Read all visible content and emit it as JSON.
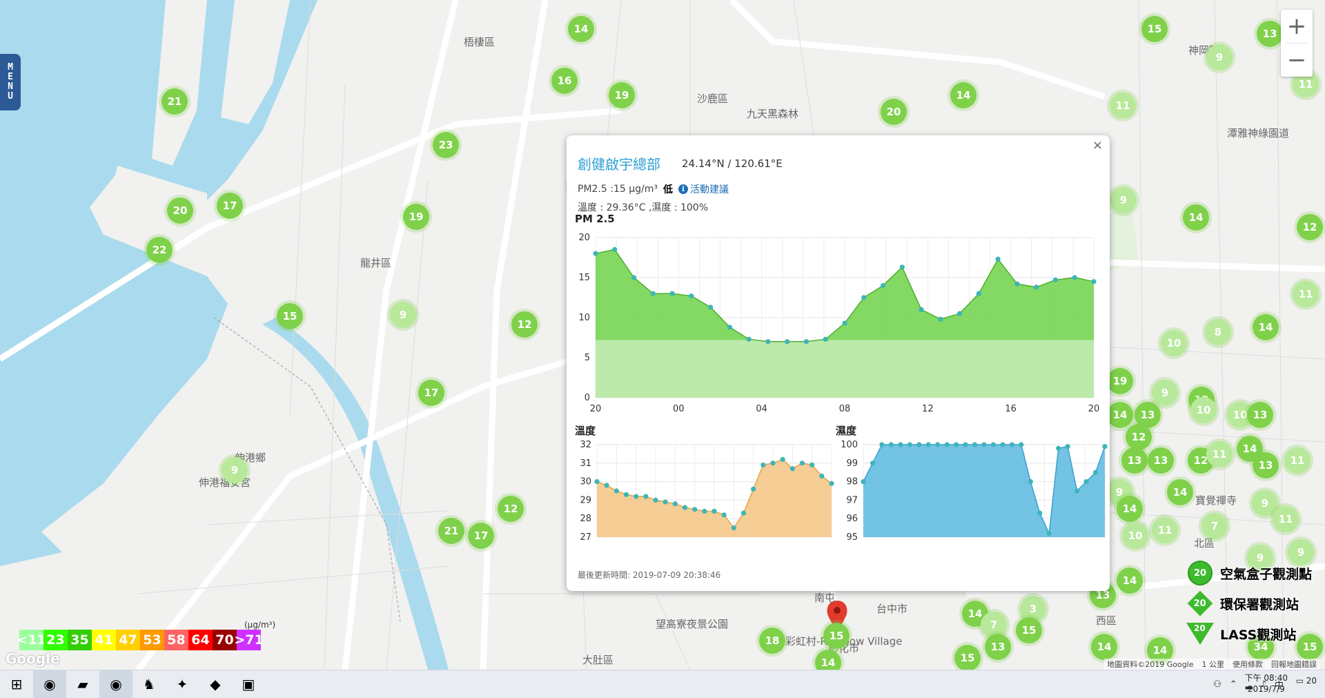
{
  "menu_label": "MENU",
  "zoom": {
    "in_label": "+",
    "out_label": "−"
  },
  "places": [
    {
      "name": "梧棲區",
      "x": 672,
      "y": 50
    },
    {
      "name": "沙鹿區",
      "x": 1010,
      "y": 132
    },
    {
      "name": "九天黑森林",
      "x": 1082,
      "y": 154
    },
    {
      "name": "龍井區",
      "x": 522,
      "y": 370
    },
    {
      "name": "伸港鄉",
      "x": 340,
      "y": 652
    },
    {
      "name": "伸港福安宮",
      "x": 288,
      "y": 688
    },
    {
      "name": "望高寮夜景公園",
      "x": 950,
      "y": 893
    },
    {
      "name": "大肚區",
      "x": 844,
      "y": 945
    },
    {
      "name": "彰化市",
      "x": 1200,
      "y": 928
    },
    {
      "name": "台中市",
      "x": 1270,
      "y": 871
    },
    {
      "name": "神岡區",
      "x": 1722,
      "y": 62
    },
    {
      "name": "潭雅神綠園道",
      "x": 1778,
      "y": 182
    },
    {
      "name": "寶覺禪寺",
      "x": 1732,
      "y": 714
    },
    {
      "name": "北區",
      "x": 1730,
      "y": 776
    },
    {
      "name": "西區",
      "x": 1588,
      "y": 888
    },
    {
      "name": "彩虹村-Rainbow Village",
      "x": 1138,
      "y": 918
    },
    {
      "name": "南屯",
      "x": 1180,
      "y": 855
    }
  ],
  "markers": [
    {
      "v": "14",
      "x": 842,
      "y": 42
    },
    {
      "v": "16",
      "x": 818,
      "y": 117
    },
    {
      "v": "19",
      "x": 901,
      "y": 138
    },
    {
      "v": "21",
      "x": 253,
      "y": 147
    },
    {
      "v": "23",
      "x": 646,
      "y": 210
    },
    {
      "v": "20",
      "x": 261,
      "y": 305
    },
    {
      "v": "17",
      "x": 333,
      "y": 298
    },
    {
      "v": "22",
      "x": 231,
      "y": 362
    },
    {
      "v": "19",
      "x": 603,
      "y": 314
    },
    {
      "v": "15",
      "x": 420,
      "y": 458
    },
    {
      "v": "9",
      "x": 584,
      "y": 456,
      "light": true
    },
    {
      "v": "12",
      "x": 760,
      "y": 470
    },
    {
      "v": "17",
      "x": 625,
      "y": 569
    },
    {
      "v": "9",
      "x": 340,
      "y": 681,
      "light": true
    },
    {
      "v": "12",
      "x": 740,
      "y": 737
    },
    {
      "v": "21",
      "x": 654,
      "y": 769
    },
    {
      "v": "17",
      "x": 697,
      "y": 776
    },
    {
      "v": "18",
      "x": 1119,
      "y": 928
    },
    {
      "v": "15",
      "x": 1212,
      "y": 921
    },
    {
      "v": "14",
      "x": 1200,
      "y": 960
    },
    {
      "v": "20",
      "x": 1295,
      "y": 162
    },
    {
      "v": "14",
      "x": 1396,
      "y": 138
    },
    {
      "v": "15",
      "x": 1673,
      "y": 42
    },
    {
      "v": "13",
      "x": 1840,
      "y": 49
    },
    {
      "v": "9",
      "x": 1767,
      "y": 83,
      "light": true
    },
    {
      "v": "11",
      "x": 1892,
      "y": 122,
      "light": true
    },
    {
      "v": "11",
      "x": 1627,
      "y": 153,
      "light": true
    },
    {
      "v": "9",
      "x": 1628,
      "y": 290,
      "light": true
    },
    {
      "v": "14",
      "x": 1733,
      "y": 315
    },
    {
      "v": "12",
      "x": 1898,
      "y": 329
    },
    {
      "v": "11",
      "x": 1892,
      "y": 426,
      "light": true
    },
    {
      "v": "8",
      "x": 1765,
      "y": 481,
      "light": true
    },
    {
      "v": "10",
      "x": 1701,
      "y": 497,
      "light": true
    },
    {
      "v": "14",
      "x": 1834,
      "y": 474
    },
    {
      "v": "19",
      "x": 1623,
      "y": 552
    },
    {
      "v": "9",
      "x": 1688,
      "y": 569,
      "light": true
    },
    {
      "v": "13",
      "x": 1741,
      "y": 579
    },
    {
      "v": "14",
      "x": 1623,
      "y": 601
    },
    {
      "v": "13",
      "x": 1663,
      "y": 601
    },
    {
      "v": "10",
      "x": 1744,
      "y": 594,
      "light": true
    },
    {
      "v": "10",
      "x": 1797,
      "y": 601,
      "light": true
    },
    {
      "v": "13",
      "x": 1826,
      "y": 601
    },
    {
      "v": "12",
      "x": 1650,
      "y": 633
    },
    {
      "v": "14",
      "x": 1811,
      "y": 650
    },
    {
      "v": "13",
      "x": 1644,
      "y": 667
    },
    {
      "v": "13",
      "x": 1682,
      "y": 667
    },
    {
      "v": "12",
      "x": 1740,
      "y": 667
    },
    {
      "v": "11",
      "x": 1767,
      "y": 658,
      "light": true
    },
    {
      "v": "13",
      "x": 1834,
      "y": 674
    },
    {
      "v": "11",
      "x": 1880,
      "y": 667,
      "light": true
    },
    {
      "v": "9",
      "x": 1622,
      "y": 713,
      "light": true
    },
    {
      "v": "14",
      "x": 1710,
      "y": 713
    },
    {
      "v": "14",
      "x": 1637,
      "y": 737
    },
    {
      "v": "9",
      "x": 1833,
      "y": 729,
      "light": true
    },
    {
      "v": "11",
      "x": 1863,
      "y": 752,
      "light": true
    },
    {
      "v": "10",
      "x": 1645,
      "y": 776,
      "light": true
    },
    {
      "v": "11",
      "x": 1688,
      "y": 768,
      "light": true
    },
    {
      "v": "7",
      "x": 1760,
      "y": 762,
      "light": true
    },
    {
      "v": "9",
      "x": 1826,
      "y": 808,
      "light": true
    },
    {
      "v": "9",
      "x": 1885,
      "y": 800,
      "light": true
    },
    {
      "v": "14",
      "x": 1637,
      "y": 841
    },
    {
      "v": "13",
      "x": 1598,
      "y": 862
    },
    {
      "v": "14",
      "x": 1413,
      "y": 889
    },
    {
      "v": "7",
      "x": 1440,
      "y": 905,
      "light": true
    },
    {
      "v": "3",
      "x": 1497,
      "y": 882,
      "light": true
    },
    {
      "v": "15",
      "x": 1491,
      "y": 913
    },
    {
      "v": "13",
      "x": 1446,
      "y": 937
    },
    {
      "v": "15",
      "x": 1402,
      "y": 953
    },
    {
      "v": "14",
      "x": 1600,
      "y": 937
    },
    {
      "v": "14",
      "x": 1681,
      "y": 942
    },
    {
      "v": "34",
      "x": 1827,
      "y": 937
    },
    {
      "v": "15",
      "x": 1898,
      "y": 937
    }
  ],
  "pm_legend": {
    "unit": "(μg/m³)",
    "segments": [
      {
        "label": "<11",
        "color": "#9cff9c"
      },
      {
        "label": "23",
        "color": "#31ff00"
      },
      {
        "label": "35",
        "color": "#31cf00"
      },
      {
        "label": "41",
        "color": "#ffff00"
      },
      {
        "label": "47",
        "color": "#ffcf00"
      },
      {
        "label": "53",
        "color": "#ff9a00"
      },
      {
        "label": "58",
        "color": "#ff6464"
      },
      {
        "label": "64",
        "color": "#ff0000"
      },
      {
        "label": "70",
        "color": "#990000"
      },
      {
        "label": ">71",
        "color": "#ce30ff"
      }
    ]
  },
  "google_logo": "Google",
  "station_legend": [
    {
      "type": "circle",
      "value": "20",
      "label": "空氣盒子觀測點"
    },
    {
      "type": "diamond",
      "value": "20",
      "label": "環保署觀測站"
    },
    {
      "type": "triangle",
      "value": "20",
      "label": "LASS觀測站"
    }
  ],
  "attribution": {
    "map_data": "地圖資料©2019 Google",
    "scale": "1 公里",
    "terms": "使用條款",
    "report": "回報地圖錯誤"
  },
  "popup": {
    "close": "×",
    "title": "創健啟宇總部",
    "coords": "24.14°N / 120.61°E",
    "pm_text": "PM2.5 :15 μg/m³",
    "pm_level": "低",
    "activity_label": "活動建議",
    "env_text": "溫度 : 29.36°C ,濕度 : 100%",
    "updated": "最後更新時間: 2019-07-09 20:38:46"
  },
  "chart_data": [
    {
      "type": "area",
      "title": "PM 2.5",
      "x_ticks": [
        "20",
        "00",
        "04",
        "08",
        "12",
        "16",
        "20"
      ],
      "ylim": [
        0,
        20
      ],
      "y_ticks": [
        0,
        5,
        10,
        15,
        20
      ],
      "grid": true,
      "color": "#6fd24a",
      "values": [
        18,
        18.5,
        15,
        13,
        13,
        12.7,
        11.3,
        8.8,
        7.3,
        7,
        7,
        7,
        7.3,
        9.3,
        12.5,
        14,
        16.3,
        11,
        9.8,
        10.5,
        13,
        17.3,
        14.2,
        13.8,
        14.7,
        15,
        14.5
      ]
    },
    {
      "type": "area",
      "title": "溫度",
      "ylim": [
        27,
        32
      ],
      "y_ticks": [
        27,
        28,
        29,
        30,
        31,
        32
      ],
      "grid": true,
      "color": "#f3c483",
      "values": [
        30,
        29.8,
        29.5,
        29.3,
        29.2,
        29.2,
        29.0,
        28.9,
        28.8,
        28.6,
        28.5,
        28.4,
        28.4,
        28.2,
        27.5,
        28.3,
        29.6,
        30.9,
        31.0,
        31.2,
        30.7,
        31.0,
        30.9,
        30.3,
        29.9
      ]
    },
    {
      "type": "area",
      "title": "濕度",
      "ylim": [
        95,
        100
      ],
      "y_ticks": [
        95,
        96,
        97,
        98,
        99,
        100
      ],
      "grid": true,
      "color": "#5bb8e0",
      "values": [
        98,
        99,
        100,
        100,
        100,
        100,
        100,
        100,
        100,
        100,
        100,
        100,
        100,
        100,
        100,
        100,
        100,
        100,
        98,
        96.3,
        95.2,
        99.8,
        99.9,
        97.5,
        98,
        98.5,
        99.9
      ]
    }
  ],
  "taskbar": {
    "items": [
      {
        "icon": "windows-start-icon",
        "glyph": "⊞"
      },
      {
        "icon": "chrome-icon",
        "glyph": "◉"
      },
      {
        "icon": "file-explorer-icon",
        "glyph": "▰"
      },
      {
        "icon": "chrome-alt-icon",
        "glyph": "◉"
      },
      {
        "icon": "app-rabbit-icon",
        "glyph": "♞"
      },
      {
        "icon": "app-bird-icon",
        "glyph": "✦"
      },
      {
        "icon": "app-red-icon",
        "glyph": "◆"
      },
      {
        "icon": "app-note-icon",
        "glyph": "▣"
      }
    ],
    "ime": "中",
    "time": "下午 08:40",
    "date": "2019/7/9",
    "notification_count": "20"
  }
}
